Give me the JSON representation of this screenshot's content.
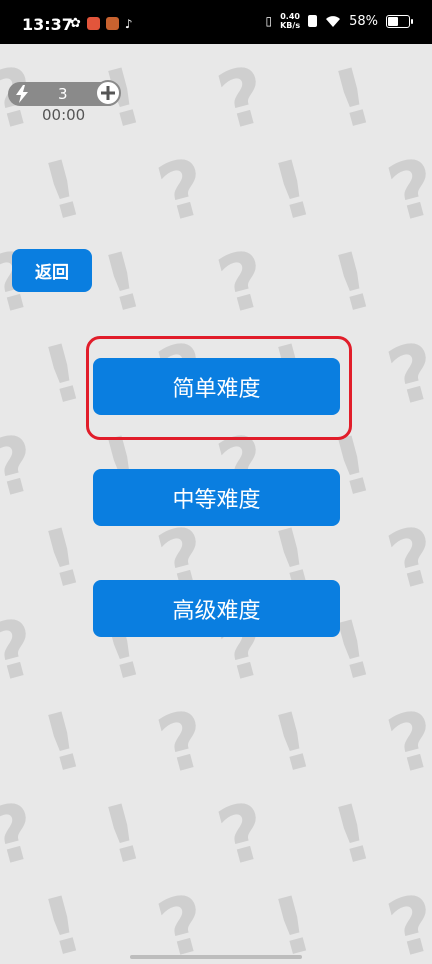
{
  "status_bar": {
    "time": "13:37",
    "net_speed_value": "0.40",
    "net_speed_unit": "KB/s",
    "battery_percent": "58%",
    "battery_level": 0.58,
    "app_icon_colors": [
      "#ffffff",
      "#e2553b",
      "#c8622f",
      "#ffffff"
    ]
  },
  "game": {
    "energy_count": "3",
    "timer": "00:00",
    "back_label": "返回",
    "difficulty_options": [
      "简单难度",
      "中等难度",
      "高级难度"
    ],
    "highlight_color": "#e11d2a",
    "accent_color": "#0a7ee0"
  }
}
